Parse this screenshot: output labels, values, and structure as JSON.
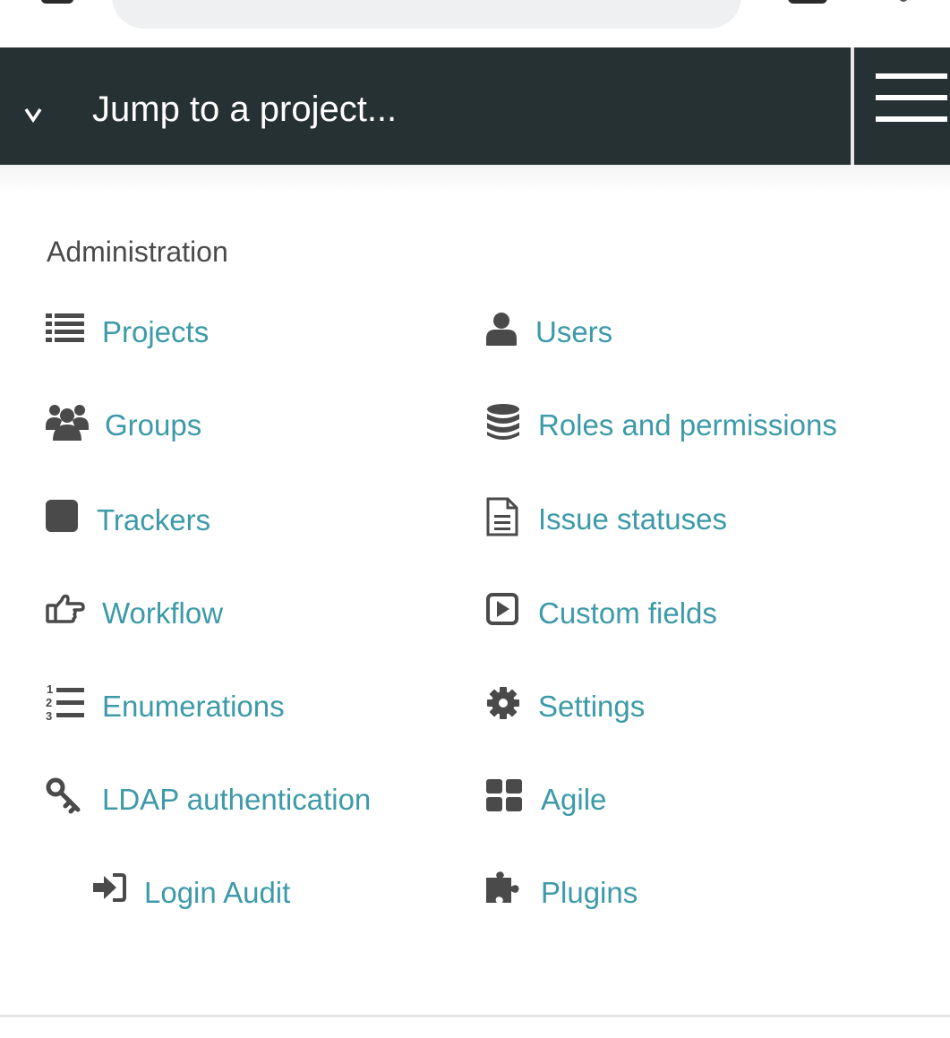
{
  "header": {
    "jump_label": "Jump to a project...",
    "chevron": "v"
  },
  "admin": {
    "title": "Administration",
    "left": [
      {
        "label": "Projects",
        "icon": "list-icon"
      },
      {
        "label": "Groups",
        "icon": "users-group-icon"
      },
      {
        "label": "Trackers",
        "icon": "square-icon"
      },
      {
        "label": "Workflow",
        "icon": "hand-point-right-icon"
      },
      {
        "label": "Enumerations",
        "icon": "ordered-list-icon"
      },
      {
        "label": "LDAP authentication",
        "icon": "key-icon"
      },
      {
        "label": "Login Audit",
        "icon": "sign-in-icon"
      }
    ],
    "right": [
      {
        "label": "Users",
        "icon": "user-icon"
      },
      {
        "label": "Roles and permissions",
        "icon": "database-icon"
      },
      {
        "label": "Issue statuses",
        "icon": "document-icon"
      },
      {
        "label": "Custom fields",
        "icon": "play-square-icon"
      },
      {
        "label": "Settings",
        "icon": "gear-icon"
      },
      {
        "label": "Agile",
        "icon": "grid-icon"
      },
      {
        "label": "Plugins",
        "icon": "puzzle-icon"
      }
    ]
  },
  "colors": {
    "nav_bg": "#263134",
    "link": "#3d9aa8",
    "icon": "#4a4a4a",
    "heading": "#4a4a4a"
  }
}
